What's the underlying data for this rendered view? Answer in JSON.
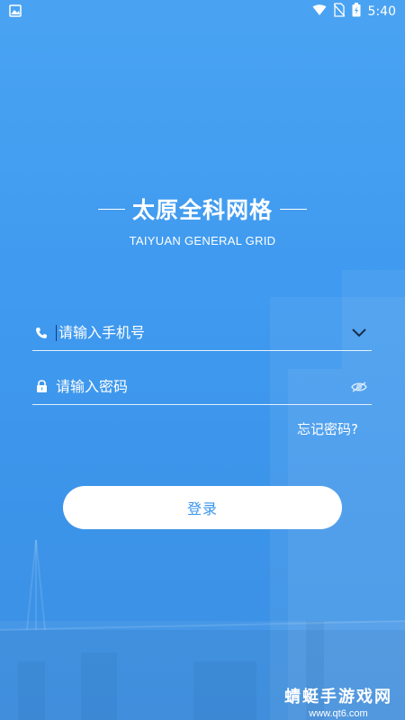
{
  "status_bar": {
    "time": "5:40",
    "icons": [
      "image-icon",
      "wifi-icon",
      "no-sim-icon",
      "battery-charging-icon"
    ]
  },
  "brand": {
    "title": "太原全科网格",
    "subtitle": "TAIYUAN GENERAL GRID"
  },
  "login_form": {
    "phone_placeholder": "请输入手机号",
    "phone_value": "",
    "password_placeholder": "请输入密码",
    "password_value": "",
    "forgot_label": "忘记密码?",
    "submit_label": "登录"
  },
  "watermark": {
    "title": "蜻蜓手游戏网",
    "url": "www.qt6.com"
  },
  "colors": {
    "background": "#4aa3f2",
    "button_text": "#3a96ee",
    "button_bg": "#ffffff"
  }
}
